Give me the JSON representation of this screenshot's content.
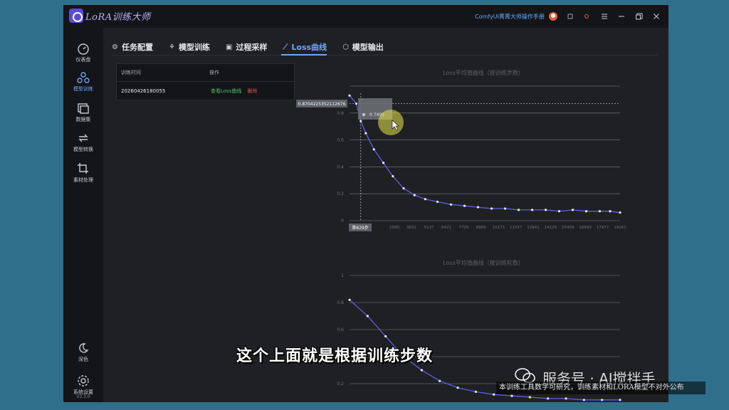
{
  "app": {
    "title": "LoRA训练大师",
    "manual_link": "ComfyUI菁菁大师操作手册",
    "version": "V3.3.0"
  },
  "sidebar": {
    "items": [
      {
        "label": "仪表盘",
        "icon": "gauge-icon"
      },
      {
        "label": "模型训练",
        "icon": "model-train-icon"
      },
      {
        "label": "数据集",
        "icon": "dataset-icon"
      },
      {
        "label": "模型转换",
        "icon": "convert-icon"
      },
      {
        "label": "素材处理",
        "icon": "crop-icon"
      }
    ],
    "theme_label": "深色",
    "settings_label": "系统设置"
  },
  "tabs": [
    {
      "label": "任务配置",
      "icon": "gear-icon"
    },
    {
      "label": "模型训练",
      "icon": "model-icon"
    },
    {
      "label": "过程采样",
      "icon": "image-icon"
    },
    {
      "label": "Loss曲线",
      "icon": "line-chart-icon"
    },
    {
      "label": "模型输出",
      "icon": "cube-icon"
    }
  ],
  "records": {
    "headers": [
      "训练时间",
      "操作"
    ],
    "rows": [
      {
        "time": "20260426180055",
        "view": "查看Loss曲线",
        "delete": "删除"
      }
    ]
  },
  "tooltip": {
    "value_label": "0.8704225352112676",
    "x_label": "第829步",
    "hover_value": "0.7409"
  },
  "chart_data": [
    {
      "type": "line",
      "title": "Loss平均值曲线（按训练步数）",
      "xlabel": "",
      "ylabel": "",
      "ylim": [
        0,
        1
      ],
      "yticks": [
        "0",
        "0.2",
        "0.4",
        "0.6",
        "0.8"
      ],
      "xticks": [
        "2580",
        "3831",
        "5137",
        "6421",
        "7705",
        "8989",
        "10273",
        "11557",
        "12841",
        "14125",
        "15409",
        "16693",
        "17977",
        "19261"
      ],
      "x": [
        0,
        500,
        829,
        1200,
        1800,
        2500,
        3200,
        4000,
        4800,
        5600,
        6500,
        7500,
        8500,
        9500,
        10500,
        11500,
        12500,
        13500,
        14500,
        15500,
        16500,
        17500,
        18500,
        19261,
        20000
      ],
      "values": [
        0.93,
        0.87,
        0.74,
        0.65,
        0.53,
        0.43,
        0.33,
        0.24,
        0.19,
        0.16,
        0.14,
        0.12,
        0.11,
        0.1,
        0.09,
        0.09,
        0.08,
        0.08,
        0.08,
        0.07,
        0.08,
        0.07,
        0.07,
        0.07,
        0.06
      ],
      "grid": true
    },
    {
      "type": "line",
      "title": "Loss平均值曲线（按训练轮数）",
      "xlabel": "",
      "ylabel": "",
      "ylim": [
        0,
        1
      ],
      "yticks": [
        "0.2",
        "0.4",
        "0.6",
        "0.8",
        "1"
      ],
      "x": [
        0,
        1,
        2,
        3,
        4,
        5,
        6,
        7,
        8,
        9,
        10,
        11,
        12,
        13,
        14,
        15
      ],
      "values": [
        0.82,
        0.7,
        0.55,
        0.4,
        0.3,
        0.22,
        0.17,
        0.14,
        0.12,
        0.11,
        0.1,
        0.09,
        0.09,
        0.08,
        0.08,
        0.08
      ],
      "grid": true
    }
  ],
  "overlay": {
    "subtitle": "这个上面就是根据训练步数",
    "watermark": "服务号 · AI搅拌手",
    "watermark_bar": "本训练工具数字可研究，训练素材和LORA模型不对外公布"
  },
  "colors": {
    "accent": "#6aa7ff",
    "line": "#5b62e8",
    "success": "#4fc26a",
    "danger": "#e05050"
  }
}
